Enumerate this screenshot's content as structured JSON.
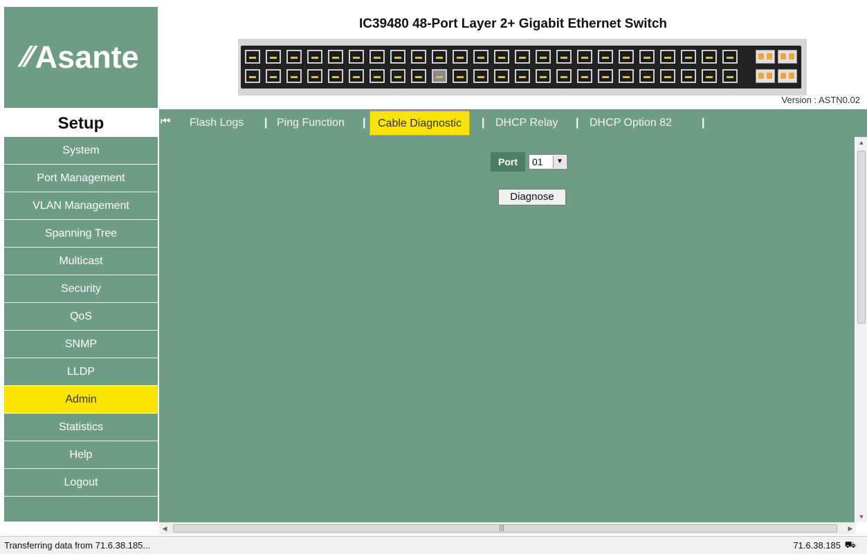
{
  "header": {
    "brand": "Asante",
    "title": "IC39480 48-Port Layer 2+ Gigabit Ethernet Switch",
    "version_label": "Version :",
    "version_value": "ASTN0.02"
  },
  "setup_label": "Setup",
  "tabs": [
    {
      "label": "Flash Logs",
      "active": false
    },
    {
      "label": "Ping Function",
      "active": false
    },
    {
      "label": "Cable Diagnostic",
      "active": true
    },
    {
      "label": "DHCP Relay",
      "active": false
    },
    {
      "label": "DHCP Option 82",
      "active": false
    }
  ],
  "sidebar": {
    "items": [
      {
        "label": "System",
        "active": false
      },
      {
        "label": "Port Management",
        "active": false
      },
      {
        "label": "VLAN Management",
        "active": false
      },
      {
        "label": "Spanning Tree",
        "active": false
      },
      {
        "label": "Multicast",
        "active": false
      },
      {
        "label": "Security",
        "active": false
      },
      {
        "label": "QoS",
        "active": false
      },
      {
        "label": "SNMP",
        "active": false
      },
      {
        "label": "LLDP",
        "active": false
      },
      {
        "label": "Admin",
        "active": true
      },
      {
        "label": "Statistics",
        "active": false
      },
      {
        "label": "Help",
        "active": false
      },
      {
        "label": "Logout",
        "active": false
      }
    ]
  },
  "form": {
    "port_label": "Port",
    "port_value": "01",
    "diagnose_label": "Diagnose"
  },
  "status": {
    "message": "Transferring data from 71.6.38.185...",
    "ip": "71.6.38.185"
  },
  "colors": {
    "panel_green": "#6e9c85",
    "active_yellow": "#f9e400"
  }
}
